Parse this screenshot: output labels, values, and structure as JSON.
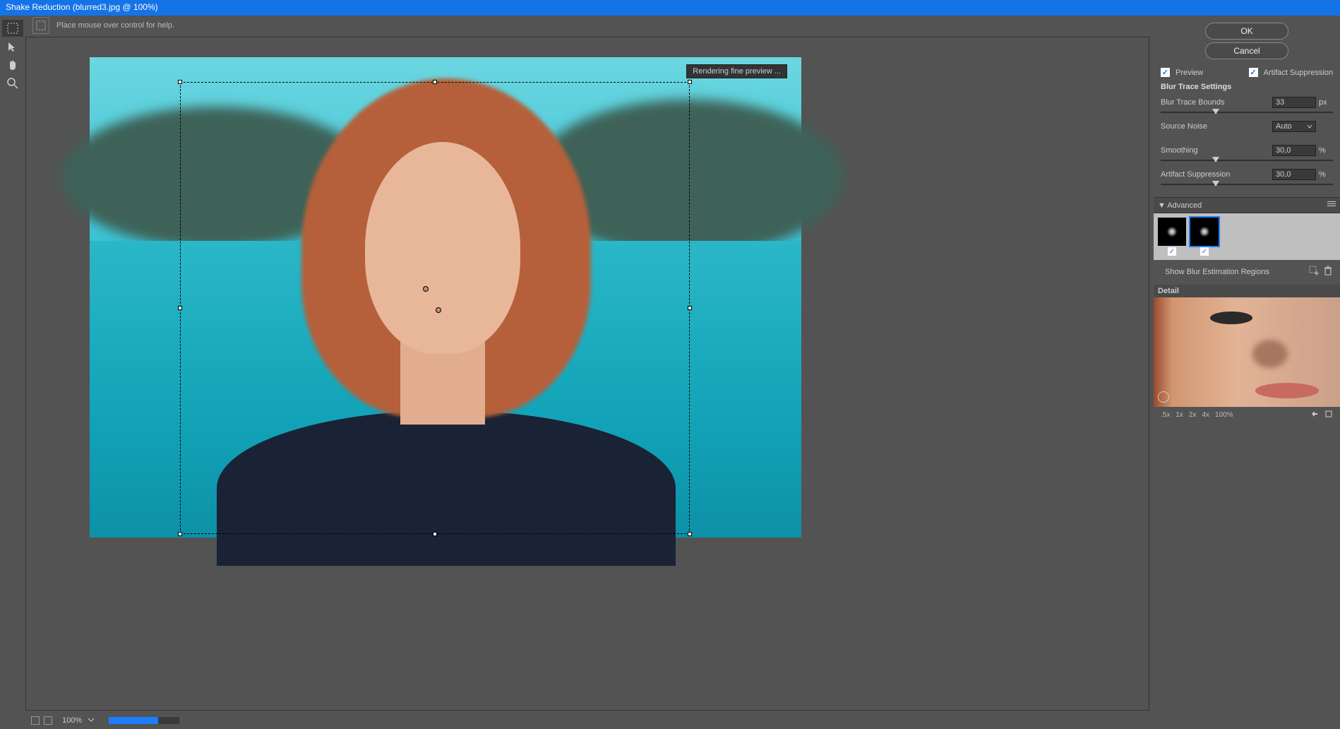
{
  "title": "Shake Reduction (blurred3.jpg @ 100%)",
  "help_text": "Place mouse over control for help.",
  "render_badge": "Rendering fine preview ...",
  "bottom": {
    "zoom": "100%"
  },
  "right": {
    "ok": "OK",
    "cancel": "Cancel",
    "preview": "Preview",
    "artifact_suppression_cb": "Artifact Suppression",
    "section1": "Blur Trace Settings",
    "blur_trace_bounds": {
      "label": "Blur Trace Bounds",
      "value": "33",
      "unit": "px"
    },
    "source_noise": {
      "label": "Source Noise",
      "value": "Auto"
    },
    "smoothing": {
      "label": "Smoothing",
      "value": "30,0",
      "unit": "%"
    },
    "artifact_suppression": {
      "label": "Artifact Suppression",
      "value": "30,0",
      "unit": "%"
    },
    "advanced": "Advanced",
    "show_blur_regions": "Show Blur Estimation Regions",
    "detail": "Detail",
    "zoom_levels": [
      ".5x",
      "1x",
      "2x",
      "4x",
      "100%"
    ]
  }
}
